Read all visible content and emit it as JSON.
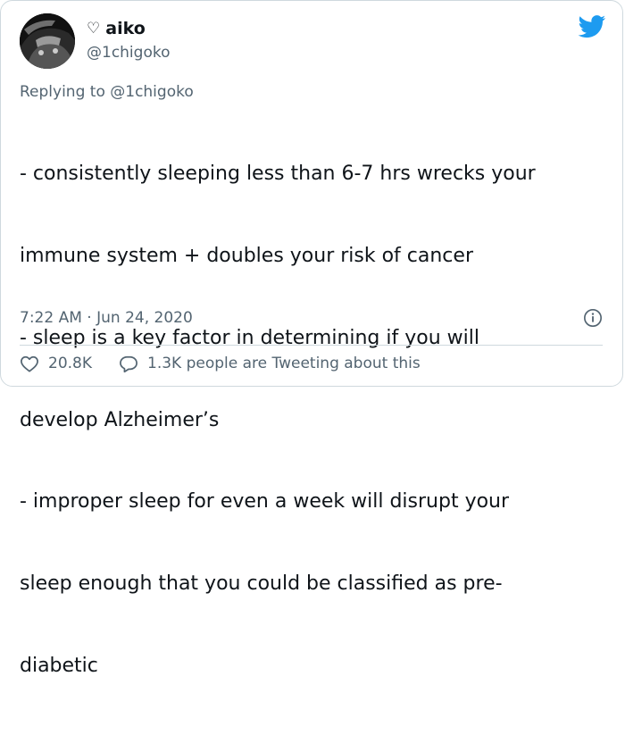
{
  "user": {
    "name": "aiko",
    "name_prefix_symbol": "♡",
    "handle": "@1chigoko"
  },
  "tweet": {
    "replying_prefix": "Replying to ",
    "replying_handle": "@1chigoko",
    "lines": [
      "- consistently sleeping less than 6-7 hrs wrecks your",
      "immune system + doubles your risk of cancer",
      "- sleep is a key factor in determining if you will",
      "develop Alzheimer’s",
      "- improper sleep for even a week will disrupt your",
      "sleep enough that you could be classified as pre-",
      "diabetic"
    ],
    "time": "7:22 AM",
    "separator": " · ",
    "date": "Jun 24, 2020"
  },
  "actions": {
    "likes_count": "20.8K",
    "conversation_text": "1.3K people are Tweeting about this"
  },
  "icons": {
    "brand": "twitter-bird-icon",
    "info": "info-icon",
    "like": "heart-icon",
    "reply": "speech-bubble-icon"
  },
  "colors": {
    "twitter_blue": "#1d9bf0",
    "secondary_text": "#536471",
    "primary_text": "#0f1419",
    "border": "#cfd9de"
  }
}
